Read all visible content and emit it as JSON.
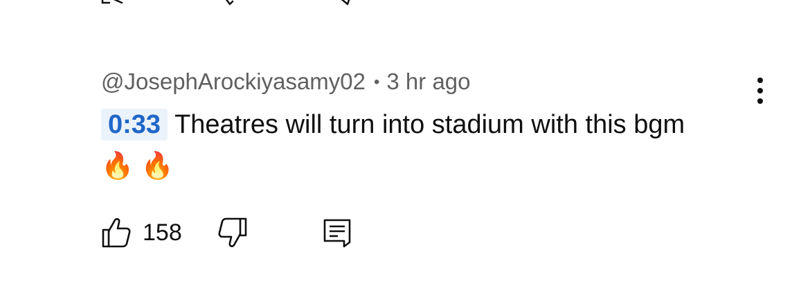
{
  "comment": {
    "author": "@JosephArockiyasamy02",
    "separator": "•",
    "time_ago": "3 hr ago",
    "timestamp_link": "0:33",
    "text": "Theatres will turn into stadium with this bgm",
    "emojis": "🔥 🔥",
    "likes": "158"
  },
  "icons": {
    "like": "thumbs-up-icon",
    "dislike": "thumbs-down-icon",
    "reply": "reply-comment-icon",
    "more": "more-vertical-icon"
  },
  "colors": {
    "timestamp_text": "#1f66c9",
    "timestamp_bg": "#eaf2fb",
    "meta_text": "#606060",
    "body_text": "#0f0f0f"
  }
}
